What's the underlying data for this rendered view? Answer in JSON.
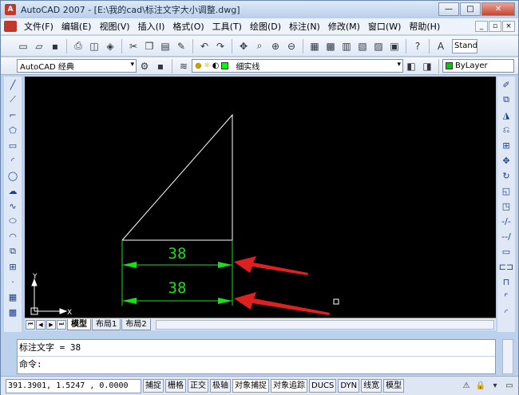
{
  "window": {
    "title": "AutoCAD 2007 - [E:\\我的cad\\标注文字大小调整.dwg]",
    "app_icon_text": "A"
  },
  "menus": [
    {
      "label": "文件(F)"
    },
    {
      "label": "编辑(E)"
    },
    {
      "label": "视图(V)"
    },
    {
      "label": "插入(I)"
    },
    {
      "label": "格式(O)"
    },
    {
      "label": "工具(T)"
    },
    {
      "label": "绘图(D)"
    },
    {
      "label": "标注(N)"
    },
    {
      "label": "修改(M)"
    },
    {
      "label": "窗口(W)"
    },
    {
      "label": "帮助(H)"
    }
  ],
  "toolbar": {
    "text_style_combo": "Stand"
  },
  "properties_bar": {
    "workspace": "AutoCAD 经典",
    "layer": "细实线",
    "color_label": "ByLayer",
    "layer_color": "#00cc00",
    "layer_swatch_color": "#00ff00"
  },
  "drawing": {
    "dimension_upper": "38",
    "dimension_lower": "38",
    "ucs_y": "Y",
    "ucs_x": "X",
    "dim_color": "#18e018",
    "line_color": "#ffffff",
    "arrow_color": "#e02020"
  },
  "tabs": [
    {
      "label": "模型"
    },
    {
      "label": "布局1"
    },
    {
      "label": "布局2"
    }
  ],
  "command": {
    "history": "标注文字 = 38",
    "prompt": "命令:"
  },
  "status": {
    "coords": "391.3901, 1.5247 , 0.0000",
    "buttons": [
      {
        "label": "捕捉"
      },
      {
        "label": "栅格"
      },
      {
        "label": "正交"
      },
      {
        "label": "极轴"
      },
      {
        "label": "对象捕捉"
      },
      {
        "label": "对象追踪"
      },
      {
        "label": "DUCS"
      },
      {
        "label": "DYN"
      },
      {
        "label": "线宽"
      },
      {
        "label": "模型"
      }
    ]
  }
}
